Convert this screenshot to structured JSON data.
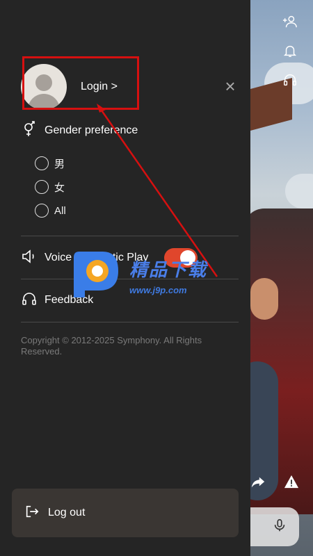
{
  "profile": {
    "login_label": "Login >"
  },
  "gender": {
    "title": "Gender preference",
    "options": [
      "男",
      "女",
      "All"
    ]
  },
  "voice": {
    "label": "Voice Automatic Play",
    "enabled": true
  },
  "feedback": {
    "label": "Feedback"
  },
  "copyright": "Copyright © 2012-2025 Symphony. All Rights Reserved.",
  "logout": {
    "label": "Log out"
  },
  "watermark": {
    "url": "www.j9p.com"
  },
  "colors": {
    "accent": "#e0462c",
    "annotation": "#d61010",
    "drawer": "#252525"
  },
  "side_icons": [
    "add-user-icon",
    "bell-icon",
    "headset-icon",
    "share-icon",
    "warning-icon",
    "microphone-icon"
  ]
}
